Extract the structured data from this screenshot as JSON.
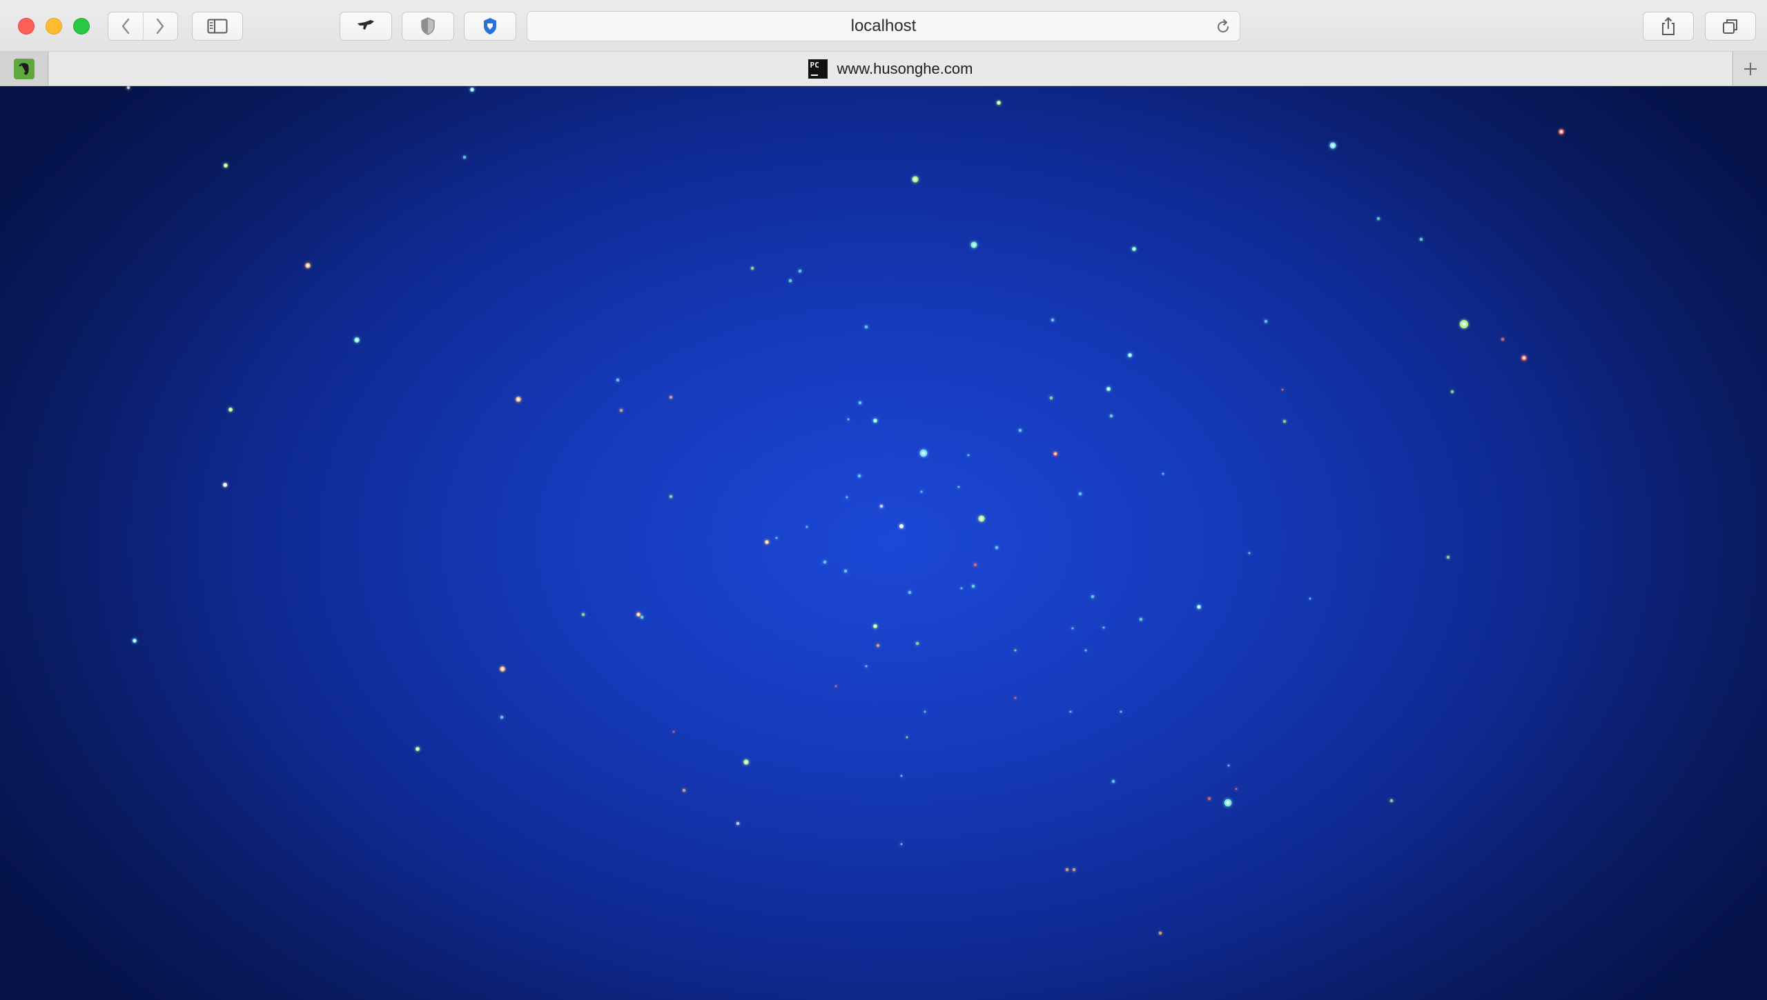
{
  "browser": {
    "address_bar": {
      "url_text": "localhost"
    },
    "tabs": [
      {
        "title": "www.husonghe.com",
        "favicon": "pycharm-icon",
        "active": true
      }
    ],
    "pinned_tabs": [
      {
        "icon": "evernote-icon"
      }
    ],
    "toolbar_icons": [
      "back-icon",
      "forward-icon",
      "sidebar-icon",
      "bird-extension-icon",
      "shield-extension-icon",
      "bitwarden-shield-icon",
      "reload-icon",
      "share-icon",
      "tabs-overview-icon",
      "new-tab-icon"
    ]
  },
  "page": {
    "background": {
      "center_color": "#1c48d6",
      "edge_color": "#06134a"
    },
    "particle_colors": [
      "#ffffff",
      "#7dffd9",
      "#7cf0ff",
      "#b8ff8a",
      "#ff7a6a",
      "#ffc27a"
    ]
  }
}
